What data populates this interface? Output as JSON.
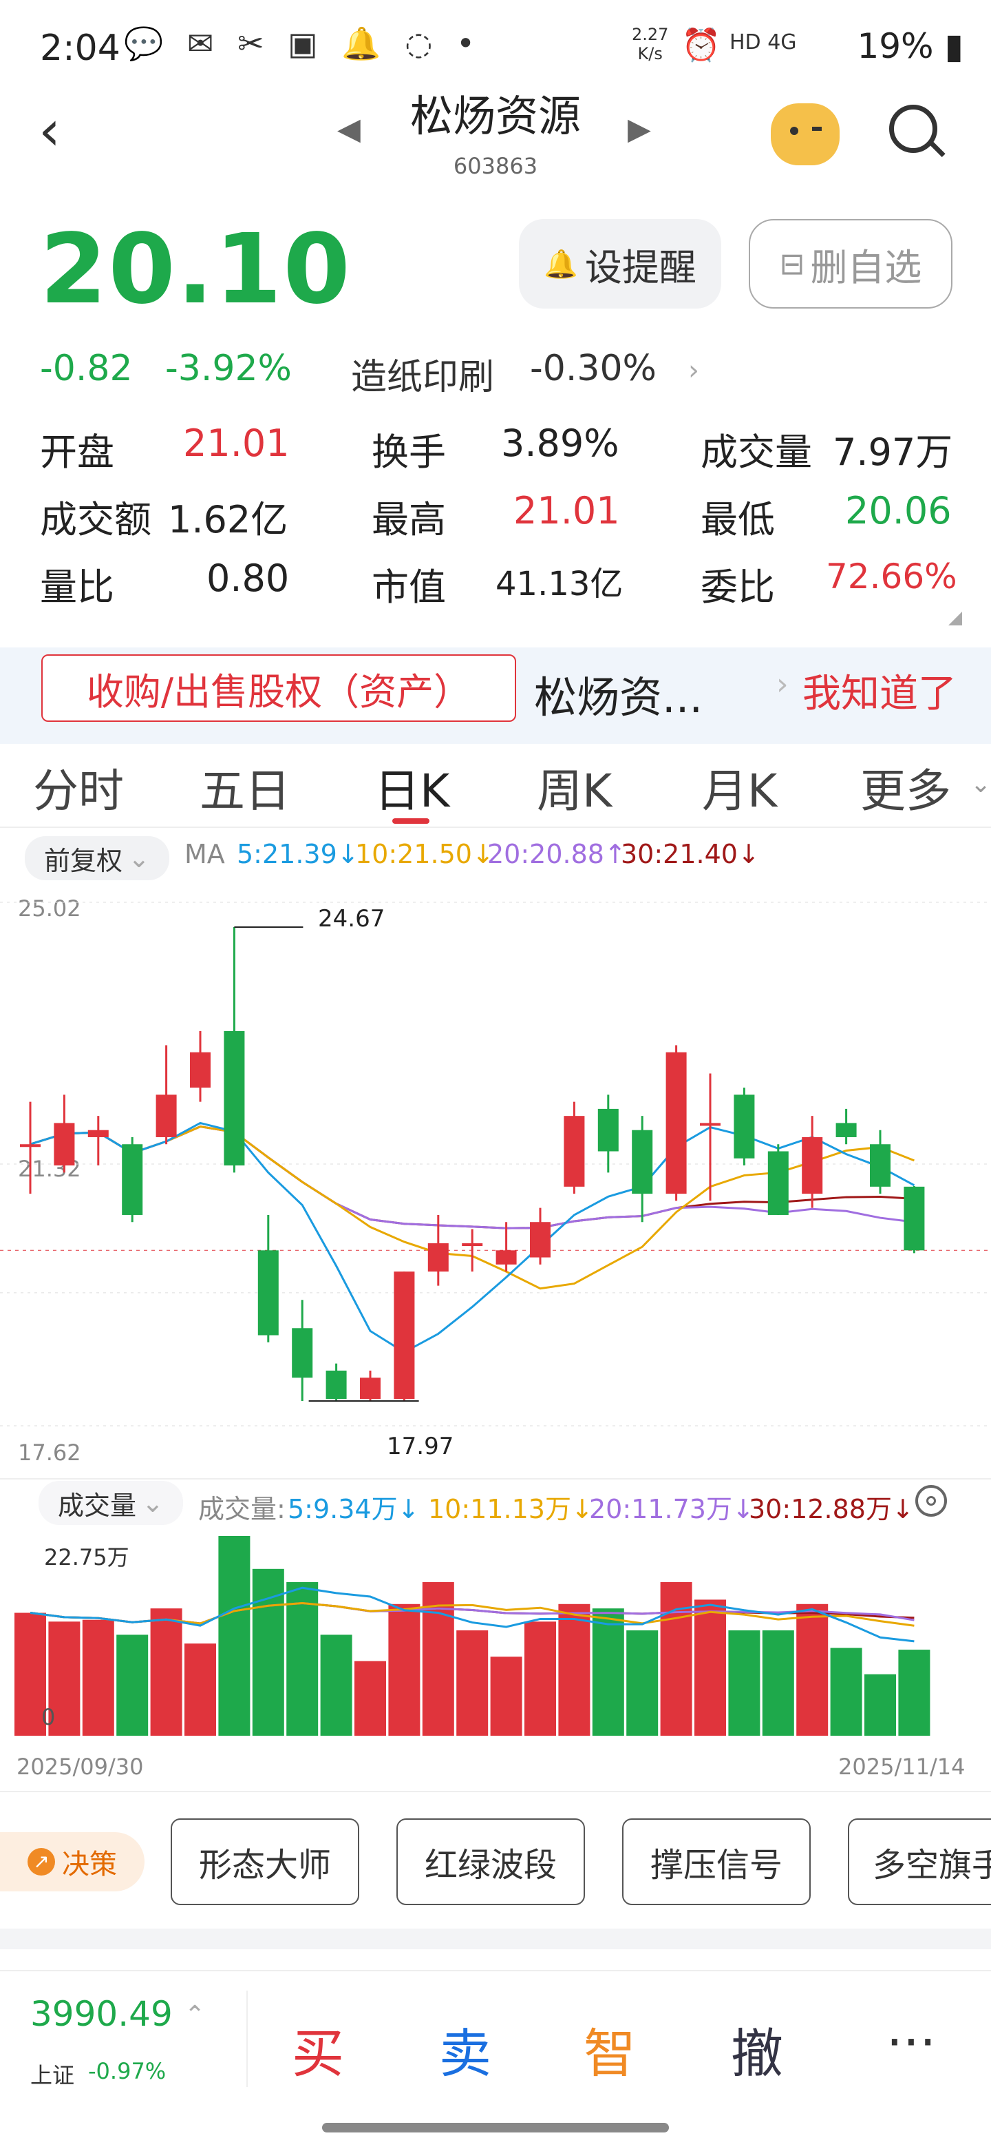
{
  "status": {
    "time": "2:04",
    "speed": "2.27\nK/s",
    "net": "HD 4G",
    "battery": "19%"
  },
  "header": {
    "name": "松炀资源",
    "code": "603863"
  },
  "quote": {
    "price": "20.10",
    "change": "-0.82",
    "pct": "-3.92%",
    "sector": "造纸印刷",
    "sector_pct": "-0.30%",
    "alert_btn": "设提醒",
    "remove_btn": "删自选"
  },
  "stats": [
    {
      "label": "开盘",
      "value": "21.01"
    },
    {
      "label": "换手",
      "value": "3.89%"
    },
    {
      "label": "成交量",
      "value": "7.97万"
    },
    {
      "label": "成交额",
      "value": "1.62亿"
    },
    {
      "label": "最高",
      "value": "21.01"
    },
    {
      "label": "最低",
      "value": "20.06"
    },
    {
      "label": "量比",
      "value": "0.80"
    },
    {
      "label": "市值",
      "value": "41.13亿"
    },
    {
      "label": "委比",
      "value": "72.66%"
    }
  ],
  "banner": {
    "tag": "收购/出售股权（资产）",
    "text": "松炀资...",
    "ack": "我知道了"
  },
  "tabs": [
    "分时",
    "五日",
    "日K",
    "周K",
    "月K",
    "更多"
  ],
  "ma": {
    "adj": "前复权",
    "prefix": "MA",
    "ma5": "5:21.39↓",
    "ma10": "10:21.50↓",
    "ma20": "20:20.88↑",
    "ma30": "30:21.40↓"
  },
  "price_axis": {
    "top": "25.02",
    "mid": "21.32",
    "bottom": "17.62"
  },
  "annotations": {
    "high": "24.67",
    "low": "17.97"
  },
  "vol": {
    "label": "成交量",
    "prefix": "成交量:",
    "v5": "5:9.34万↓",
    "v10": "10:11.13万↓",
    "v20": "20:11.73万↓",
    "v30": "30:12.88万↓",
    "max": "22.75万",
    "zero": "0"
  },
  "dates": {
    "start": "2025/09/30",
    "end": "2025/11/14"
  },
  "strategy": {
    "label": "决策",
    "items": [
      "形态大师",
      "红绿波段",
      "撑压信号",
      "多空旗手"
    ]
  },
  "footer": {
    "index_val": "3990.49",
    "index_name": "上证",
    "index_pct": "-0.97%",
    "buy": "买",
    "sell": "卖",
    "smart": "智",
    "cancel": "撤",
    "more": "···"
  },
  "colors": {
    "up": "#e0343c",
    "down": "#1ea94b",
    "ma5": "#1a9be0",
    "ma10": "#e8a800",
    "ma20": "#a06ee0",
    "ma30": "#a01818"
  },
  "chart_data": {
    "type": "candlestick",
    "dates": {
      "start": "2025/09/30",
      "end": "2025/11/14"
    },
    "ylim": [
      17.62,
      25.02
    ],
    "candles": [
      {
        "o": 21.6,
        "c": 21.6,
        "h": 22.2,
        "l": 20.9
      },
      {
        "o": 21.3,
        "c": 21.9,
        "h": 22.3,
        "l": 21.2
      },
      {
        "o": 21.7,
        "c": 21.8,
        "h": 22.0,
        "l": 21.3
      },
      {
        "o": 21.6,
        "c": 20.6,
        "h": 21.7,
        "l": 20.5
      },
      {
        "o": 21.7,
        "c": 22.3,
        "h": 23.0,
        "l": 21.6
      },
      {
        "o": 22.4,
        "c": 22.9,
        "h": 23.2,
        "l": 22.2
      },
      {
        "o": 23.2,
        "c": 21.3,
        "h": 24.67,
        "l": 21.2
      },
      {
        "o": 20.1,
        "c": 18.9,
        "h": 20.6,
        "l": 18.8
      },
      {
        "o": 19.0,
        "c": 18.3,
        "h": 19.4,
        "l": 17.97
      },
      {
        "o": 18.4,
        "c": 18.0,
        "h": 18.5,
        "l": 17.98
      },
      {
        "o": 18.0,
        "c": 18.3,
        "h": 18.4,
        "l": 17.97
      },
      {
        "o": 18.0,
        "c": 19.8,
        "h": 19.8,
        "l": 17.98
      },
      {
        "o": 19.8,
        "c": 20.2,
        "h": 20.6,
        "l": 19.6
      },
      {
        "o": 20.2,
        "c": 20.2,
        "h": 20.4,
        "l": 19.8
      },
      {
        "o": 19.9,
        "c": 20.1,
        "h": 20.5,
        "l": 19.8
      },
      {
        "o": 20.0,
        "c": 20.5,
        "h": 20.7,
        "l": 19.9
      },
      {
        "o": 21.0,
        "c": 22.0,
        "h": 22.2,
        "l": 20.9
      },
      {
        "o": 22.1,
        "c": 21.5,
        "h": 22.3,
        "l": 21.2
      },
      {
        "o": 21.8,
        "c": 20.9,
        "h": 22.0,
        "l": 20.5
      },
      {
        "o": 20.9,
        "c": 22.9,
        "h": 23.0,
        "l": 20.8
      },
      {
        "o": 21.9,
        "c": 21.9,
        "h": 22.6,
        "l": 20.8
      },
      {
        "o": 22.3,
        "c": 21.4,
        "h": 22.4,
        "l": 21.3
      },
      {
        "o": 21.5,
        "c": 20.6,
        "h": 21.6,
        "l": 20.6
      },
      {
        "o": 20.9,
        "c": 21.7,
        "h": 22.0,
        "l": 20.7
      },
      {
        "o": 21.9,
        "c": 21.7,
        "h": 22.1,
        "l": 21.6
      },
      {
        "o": 21.6,
        "c": 21.0,
        "h": 21.8,
        "l": 20.9
      },
      {
        "o": 21.0,
        "c": 20.1,
        "h": 21.01,
        "l": 20.06
      }
    ],
    "volume": [
      14.0,
      13.0,
      13.2,
      11.5,
      14.5,
      10.5,
      22.75,
      19.0,
      17.5,
      11.5,
      8.5,
      15.0,
      17.5,
      12.0,
      9.0,
      13.0,
      15.0,
      14.5,
      12.0,
      17.5,
      15.5,
      12.0,
      12.0,
      15.0,
      10.0,
      7.0,
      9.8
    ],
    "ma_values": {
      "ma5": 21.39,
      "ma10": 21.5,
      "ma20": 20.88,
      "ma30": 21.4
    }
  }
}
